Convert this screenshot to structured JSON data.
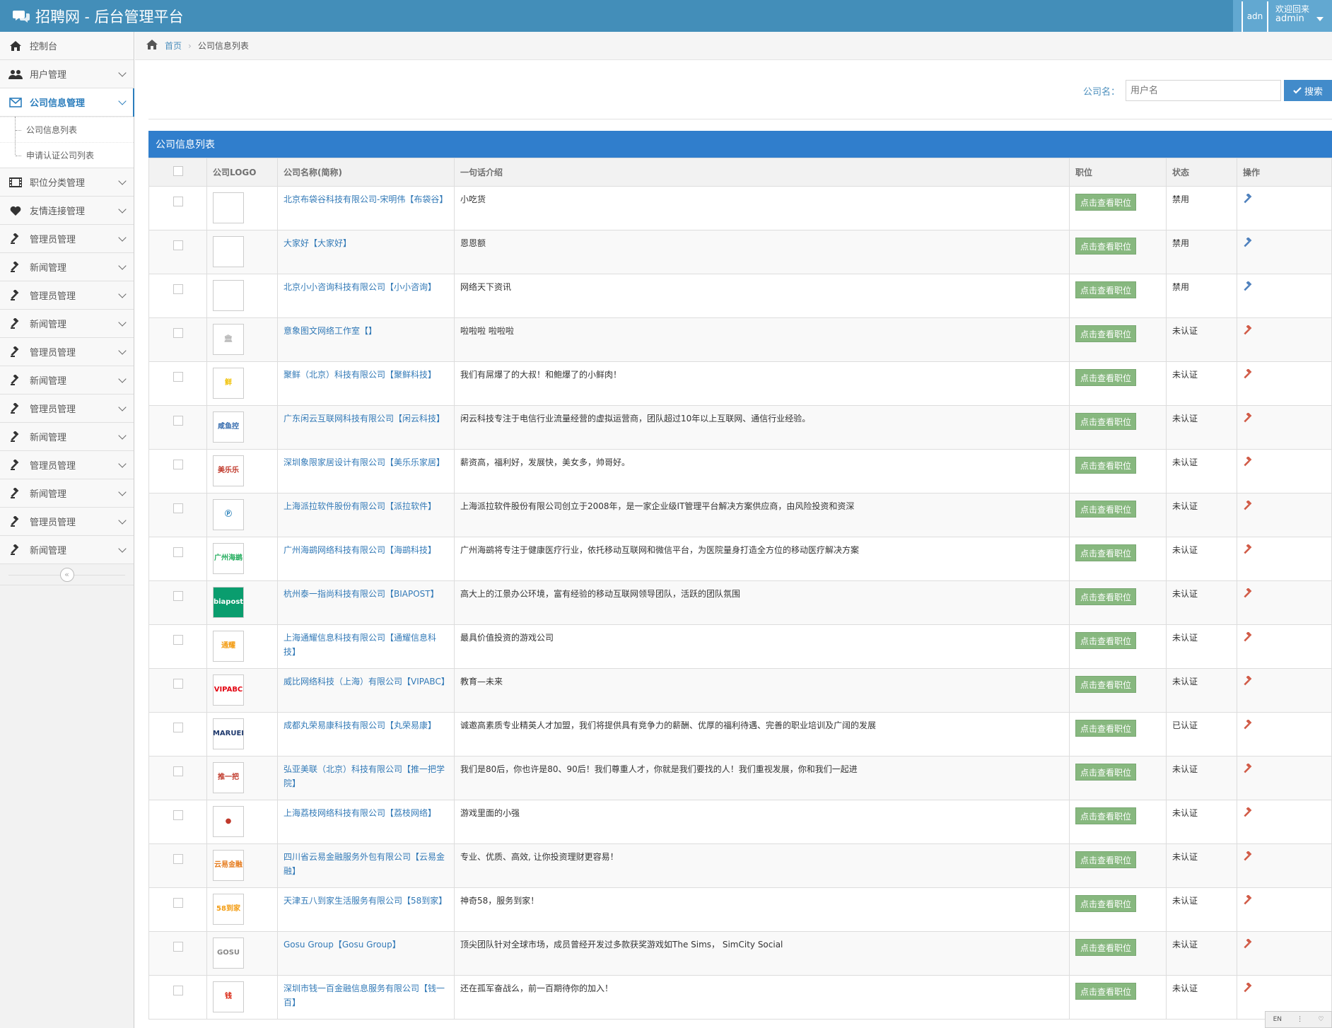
{
  "app": {
    "title": "招聘网 - 后台管理平台"
  },
  "user": {
    "avatar_alt": "adn",
    "welcome": "欢迎回来",
    "name": "admin"
  },
  "sidebar": {
    "items_top": [
      {
        "label": "控制台",
        "icon": "home-icon",
        "chevron": false
      },
      {
        "label": "用户管理",
        "icon": "users-icon",
        "chevron": true
      }
    ],
    "active": {
      "label": "公司信息管理",
      "icon": "envelope-icon"
    },
    "sub_items": [
      {
        "label": "公司信息列表"
      },
      {
        "label": "申请认证公司列表"
      }
    ],
    "items_bottom": [
      {
        "label": "职位分类管理",
        "icon": "film-icon"
      },
      {
        "label": "友情连接管理",
        "icon": "heart-icon"
      },
      {
        "label": "管理员管理",
        "icon": "gavel-icon"
      },
      {
        "label": "新闻管理",
        "icon": "gavel-icon"
      },
      {
        "label": "管理员管理",
        "icon": "gavel-icon"
      },
      {
        "label": "新闻管理",
        "icon": "gavel-icon"
      },
      {
        "label": "管理员管理",
        "icon": "gavel-icon"
      },
      {
        "label": "新闻管理",
        "icon": "gavel-icon"
      },
      {
        "label": "管理员管理",
        "icon": "gavel-icon"
      },
      {
        "label": "新闻管理",
        "icon": "gavel-icon"
      },
      {
        "label": "管理员管理",
        "icon": "gavel-icon"
      },
      {
        "label": "新闻管理",
        "icon": "gavel-icon"
      },
      {
        "label": "管理员管理",
        "icon": "gavel-icon"
      },
      {
        "label": "新闻管理",
        "icon": "gavel-icon"
      }
    ],
    "collapse_glyph": "«"
  },
  "breadcrumbs": {
    "home": "首页",
    "current": "公司信息列表"
  },
  "search": {
    "label": "公司名：",
    "placeholder": "用户名",
    "button": "搜索"
  },
  "table": {
    "title": "公司信息列表",
    "headers": [
      "",
      "公司LOGO",
      "公司名称(简称)",
      "一句话介绍",
      "职位",
      "状态",
      "操作"
    ],
    "job_button": "点击查看职位",
    "rows": [
      {
        "name": "北京布袋谷科技有限公司-宋明伟【布袋谷】",
        "intro": "小吃货",
        "status": "禁用",
        "logo": "",
        "logo_color": "#999",
        "op_color": "#4f81bd"
      },
      {
        "name": "大家好【大家好】",
        "intro": "恩恩额",
        "status": "禁用",
        "logo": "",
        "logo_color": "#999",
        "op_color": "#4f81bd"
      },
      {
        "name": "北京小小咨询科技有限公司【小小咨询】",
        "intro": "网络天下资讯",
        "status": "禁用",
        "logo": "",
        "logo_color": "#999",
        "op_color": "#4f81bd"
      },
      {
        "name": "意象图文网络工作室【】",
        "intro": "啦啦啦 啦啦啦",
        "status": "未认证",
        "logo": "🏛",
        "logo_color": "#bbb",
        "op_color": "#d15b47"
      },
      {
        "name": "聚鲜（北京）科技有限公司【聚鲜科技】",
        "intro": "我们有屌爆了的大叔！和鲍爆了的小鲜肉！",
        "status": "未认证",
        "logo": "鲜",
        "logo_color": "#f0c000",
        "op_color": "#d15b47"
      },
      {
        "name": "广东闲云互联网科技有限公司【闲云科技】",
        "intro": "闲云科技专注于电信行业流量经营的虚拟运营商，团队超过10年以上互联网、通信行业经验。",
        "status": "未认证",
        "logo": "咸鱼控",
        "logo_color": "#3a6fb0",
        "op_color": "#d15b47"
      },
      {
        "name": "深圳象限家居设计有限公司【美乐乐家居】",
        "intro": "薪资高，福利好，发展快，美女多，帅哥好。",
        "status": "未认证",
        "logo": "美乐乐",
        "logo_color": "#c0392b",
        "op_color": "#d15b47"
      },
      {
        "name": "上海派拉软件股份有限公司【派拉软件】",
        "intro": "上海派拉软件股份有限公司创立于2008年，是一家企业级IT管理平台解决方案供应商，由风险投资和资深",
        "status": "未认证",
        "logo": "Ⓟ",
        "logo_color": "#2980b9",
        "op_color": "#d15b47"
      },
      {
        "name": "广州海鹚网络科技有限公司【海鹚科技】",
        "intro": "广州海鹚将专注于健康医疗行业，依托移动互联网和微信平台，为医院量身打造全方位的移动医疗解决方案",
        "status": "未认证",
        "logo": "广州海鹚",
        "logo_color": "#27ae60",
        "op_color": "#d15b47"
      },
      {
        "name": "杭州泰一指尚科技有限公司【BIAPOST】",
        "intro": "高大上的江景办公环境，富有经验的移动互联网领导团队，活跃的团队氛围",
        "status": "未认证",
        "logo": "biapost",
        "logo_color": "#0a9d6e",
        "op_color": "#d15b47"
      },
      {
        "name": "上海通耀信息科技有限公司【通耀信息科技】",
        "intro": "最具价值投资的游戏公司",
        "status": "未认证",
        "logo": "通耀",
        "logo_color": "#f39c12",
        "op_color": "#d15b47"
      },
      {
        "name": "威比网络科技（上海）有限公司【VIPABC】",
        "intro": "教育—未来",
        "status": "未认证",
        "logo": "VIPABC",
        "logo_color": "#e30613",
        "op_color": "#d15b47"
      },
      {
        "name": "成都丸荣易康科技有限公司【丸荣易康】",
        "intro": "诚邀高素质专业精英人才加盟，我们将提供具有竞争力的薪酬、优厚的福利待遇、完善的职业培训及广阔的发展",
        "status": "已认证",
        "logo": "MARUEI",
        "logo_color": "#1f3a6e",
        "op_color": "#d15b47"
      },
      {
        "name": "弘亚美联（北京）科技有限公司【推一把学院】",
        "intro": "我们是80后，你也许是80、90后！我们尊重人才，你就是我们要找的人！我们重视发展，你和我们一起进",
        "status": "未认证",
        "logo": "推一把",
        "logo_color": "#c0392b",
        "op_color": "#d15b47"
      },
      {
        "name": "上海荔枝网络科技有限公司【荔枝网络】",
        "intro": "游戏里面的小强",
        "status": "未认证",
        "logo": "●",
        "logo_color": "#c0392b",
        "op_color": "#d15b47"
      },
      {
        "name": "四川省云易金融服务外包有限公司【云易金融】",
        "intro": "专业、优质、高效, 让你投资理财更容易！",
        "status": "未认证",
        "logo": "云易金融",
        "logo_color": "#e67e22",
        "op_color": "#d15b47"
      },
      {
        "name": "天津五八到家生活服务有限公司【58到家】",
        "intro": "神奇58，服务到家！",
        "status": "未认证",
        "logo": "58到家",
        "logo_color": "#f39c12",
        "op_color": "#d15b47"
      },
      {
        "name": "Gosu Group【Gosu Group】",
        "intro": "顶尖团队针对全球市场，成员曾经开发过多款获奖游戏如The Sims， SimCity Social",
        "status": "未认证",
        "logo": "GOSU",
        "logo_color": "#888",
        "op_color": "#d15b47"
      },
      {
        "name": "深圳市钱一百金融信息服务有限公司【钱一百】",
        "intro": "还在孤军奋战么，前一百期待你的加入！",
        "status": "未认证",
        "logo": "钱",
        "logo_color": "#d9230f",
        "op_color": "#d15b47"
      }
    ]
  },
  "langbar": {
    "lang": "EN",
    "menu": "⋮",
    "heart": "♡"
  }
}
